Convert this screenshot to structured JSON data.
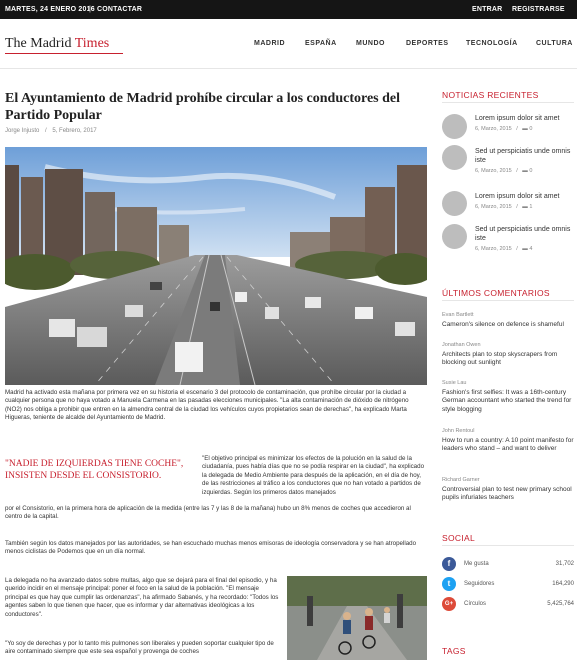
{
  "topbar": {
    "date": "MARTES, 24 ENERO 2016",
    "separator": "|",
    "contact": "CONTACTAR",
    "login": "ENTRAR",
    "register": "REGISTRARSE"
  },
  "header": {
    "logo_main": "The Madrid ",
    "logo_accent": "Times",
    "nav": [
      "MADRID",
      "ESPAÑA",
      "MUNDO",
      "DEPORTES",
      "TECNOLOGÍA",
      "CULTURA"
    ]
  },
  "article": {
    "title": "El Ayuntamiento de Madrid prohíbe circular a los conductores del Partido Popular",
    "author": "Jorge Injusto",
    "meta_sep": "/",
    "date": "5, Febrero, 2017",
    "p1": "Madrid ha activado esta mañana por primera vez en su historia el escenario 3 del protocolo de contaminación, que prohíbe circular por la ciudad a cualquier persona que no haya votado a Manuela Carmena en las pasadas elecciones municipales. \"La alta contaminación de dióxido de nitrógeno (NO2) nos obliga a prohibir que entren en la almendra central de la ciudad los vehículos cuyos propietarios sean de derechas\", ha explicado Marta Higueras, teniente de alcalde del Ayuntamiento de Madrid.",
    "pullquote": "\"NADIE DE IZQUIERDAS TIENE COCHE\", INSISTEN DESDE EL CONSISTORIO.",
    "p2_right": "\"El objetivo principal es minimizar los efectos de la polución en la salud de la ciudadanía, pues había días que no se podía respirar en la ciudad\", ha explicado la delegada de Medio Ambiente para después de la aplicación, en el día de hoy, de las restricciones al tráfico a los conductores que no han votado a partidos de izquierdas. Según los primeros datos manejados",
    "p2_full": "por el Consistorio, en la primera hora de aplicación de la medida (entre las 7 y las 8 de la mañana) hubo un 8% menos de coches que accedieron al centro de la capital.",
    "p3": "También según los datos manejados por las autoridades, se han escuchado muchas menos emisoras de ideología conservadora y se han atropellado menos ciclistas de Podemos que en un día normal.",
    "p4": "La delegada no ha avanzado datos sobre multas, algo que se dejará para el final del episodio, y ha querido incidir en el mensaje principal: poner el foco en la salud de la población. \"El mensaje principal es que hay que cumplir las ordenanzas\", ha afirmado Sabanés, y ha recordado: \"Todos los agentes saben lo que tienen que hacer, que es informar y dar alternativas ideológicas a los conductores\".",
    "p5": "\"Yo soy de derechas y por lo tanto mis pulmones son liberales y pueden soportar cualquier tipo de aire contaminado siempre que este sea español y provenga de coches"
  },
  "sidebar": {
    "recent_title": "NOTICIAS RECIENTES",
    "recent": [
      {
        "title": "Lorem ipsum dolor sit amet",
        "date": "6, Marzo, 2015",
        "sep": "/",
        "comments": "0"
      },
      {
        "title": "Sed ut perspiciatis unde omnis iste",
        "date": "6, Marzo, 2015",
        "sep": "/",
        "comments": "0"
      },
      {
        "title": "Lorem ipsum dolor sit amet",
        "date": "6, Marzo, 2015",
        "sep": "/",
        "comments": "1"
      },
      {
        "title": "Sed ut perspiciatis unde omnis iste",
        "date": "6, Marzo, 2015",
        "sep": "/",
        "comments": "4"
      }
    ],
    "comments_title": "ÚLTIMOS COMENTARIOS",
    "comments": [
      {
        "author": "Evan Bartlett",
        "text": "Cameron's silence on defence is shameful"
      },
      {
        "author": "Jonathan Owen",
        "text": "Architects plan to stop skyscrapers from blocking out sunlight"
      },
      {
        "author": "Susie Lau",
        "text": "Fashion's first selfies: It was a 16th-century German accountant who started the trend for style blogging"
      },
      {
        "author": "John Rentoul",
        "text": "How to run a country: A 10 point manifesto for leaders who stand – and want to deliver"
      },
      {
        "author": "Richard Garner",
        "text": "Controversial plan to test new primary school pupils infuriates teachers"
      }
    ],
    "social_title": "SOCIAL",
    "social": [
      {
        "icon": "facebook-icon",
        "glyph": "f",
        "color": "#3b5998",
        "label": "Me gusta",
        "count": "31,702"
      },
      {
        "icon": "twitter-icon",
        "glyph": "t",
        "color": "#1da1f2",
        "label": "Seguidores",
        "count": "164,290"
      },
      {
        "icon": "googleplus-icon",
        "glyph": "G+",
        "color": "#dd4b39",
        "label": "Círculos",
        "count": "5,425,764"
      }
    ],
    "tags_title": "TAGS"
  },
  "colors": {
    "accent": "#c7202e",
    "topbar": "#151515"
  }
}
